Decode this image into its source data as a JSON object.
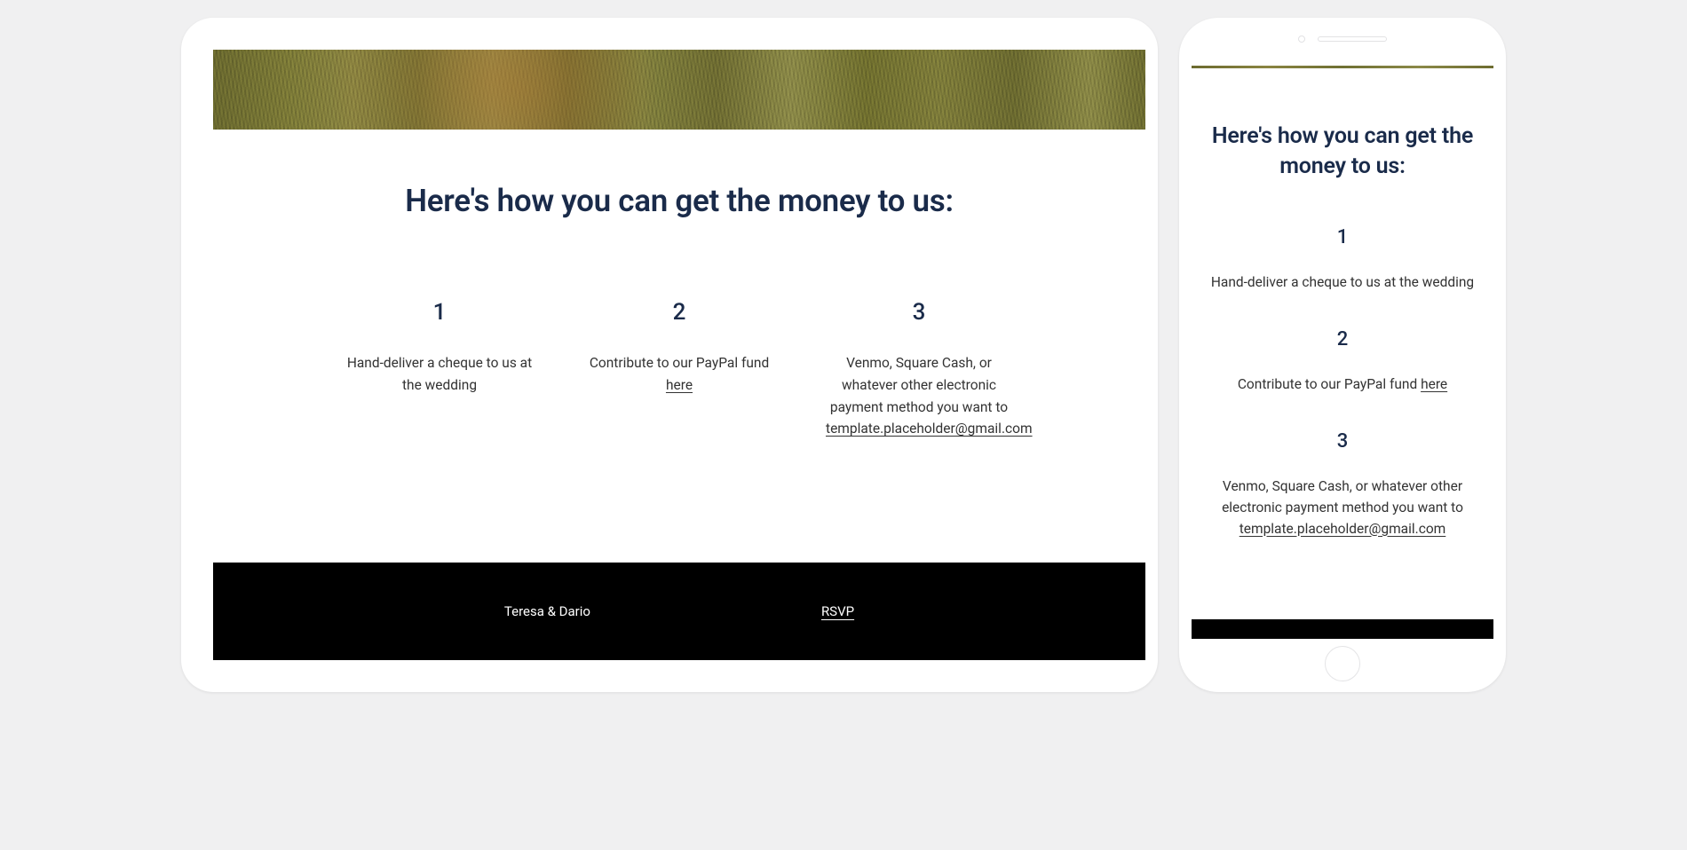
{
  "heading": "Here's how you can get the money to us:",
  "options": [
    {
      "number": "1",
      "text": "Hand-deliver a cheque to us at the wedding"
    },
    {
      "number": "2",
      "text_prefix": "Contribute to our PayPal fund ",
      "link_text": "here"
    },
    {
      "number": "3",
      "text_prefix": "Venmo, Square Cash, or whatever other electronic payment method you want to ",
      "link_text": "template.placeholder@gmail.com"
    }
  ],
  "footer": {
    "names": "Teresa & Dario",
    "rsvp": "RSVP"
  }
}
